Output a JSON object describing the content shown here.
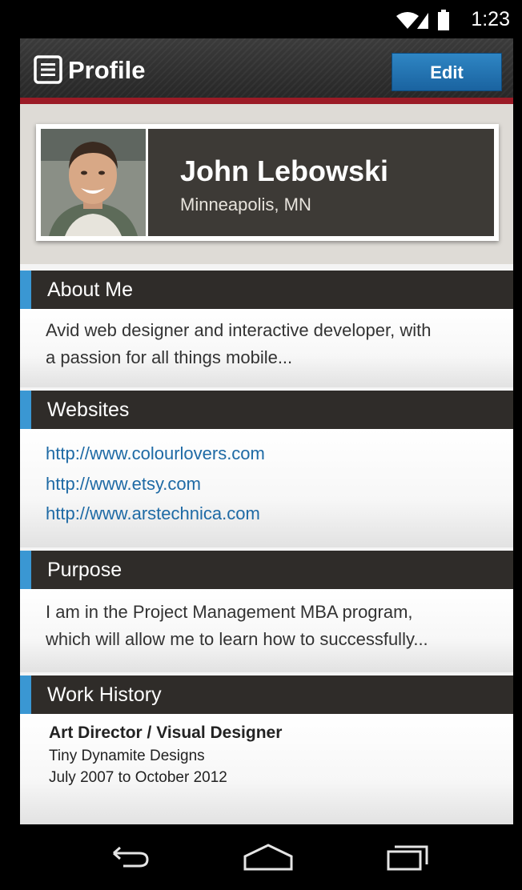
{
  "status_bar": {
    "time": "1:23",
    "icons": [
      "wifi-icon",
      "signal-icon",
      "battery-icon"
    ]
  },
  "action_bar": {
    "title": "Profile",
    "edit_label": "Edit",
    "accent_color": "#9b1b26"
  },
  "profile": {
    "name": "John Lebowski",
    "location": "Minneapolis, MN"
  },
  "sections": {
    "about": {
      "title": "About Me",
      "text_line1": "Avid web designer and interactive developer, with",
      "text_line2": "a passion for all things mobile..."
    },
    "websites": {
      "title": "Websites",
      "links": [
        "http://www.colourlovers.com",
        "http://www.etsy.com",
        "http://www.arstechnica.com"
      ]
    },
    "purpose": {
      "title": "Purpose",
      "text_line1": "I am in the Project Management MBA program,",
      "text_line2": "which will allow me to learn how to successfully..."
    },
    "work": {
      "title": "Work History",
      "job_title": "Art Director / Visual Designer",
      "company": "Tiny Dynamite Designs",
      "dates": "July 2007 to October 2012"
    }
  },
  "nav_bar": {
    "buttons": [
      "back-icon",
      "home-icon",
      "recents-icon"
    ]
  },
  "colors": {
    "section_accent": "#3a97d3",
    "link": "#1e6aa5",
    "button": "#1a63a0"
  }
}
